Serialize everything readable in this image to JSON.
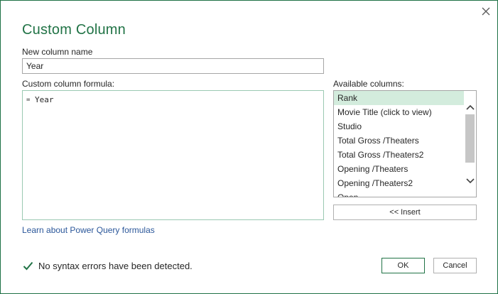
{
  "dialog": {
    "title": "Custom Column",
    "close_icon": "close-icon",
    "accent_color": "#217346",
    "name_label": "New column name",
    "name_value": "Year",
    "formula_label": "Custom column formula:",
    "formula_eq": "=",
    "formula_value": "Year",
    "columns_label": "Available columns:",
    "columns": [
      "Rank",
      "Movie Title (click to view)",
      "Studio",
      "Total Gross /Theaters",
      "Total Gross /Theaters2",
      "Opening /Theaters",
      "Opening /Theaters2",
      "Open"
    ],
    "selected_column": "Rank",
    "insert_label": "<< Insert",
    "learn_link": "Learn about Power Query formulas",
    "status_icon": "checkmark-icon",
    "status_text": "No syntax errors have been detected.",
    "ok_label": "OK",
    "cancel_label": "Cancel"
  }
}
